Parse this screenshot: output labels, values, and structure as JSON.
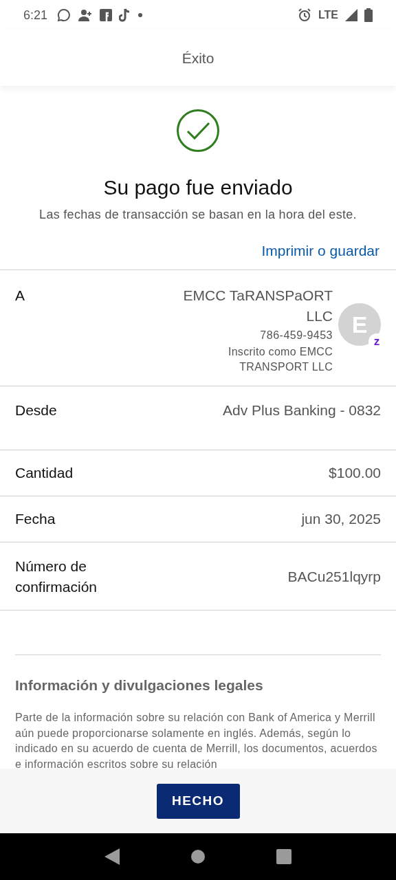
{
  "status_bar": {
    "time": "6:21",
    "network": "LTE"
  },
  "header": {
    "title": "Éxito"
  },
  "result": {
    "title": "Su pago fue enviado",
    "subtitle": "Las fechas de transacción se basan en la hora del este.",
    "print_link": "Imprimir o guardar"
  },
  "recipient": {
    "label": "A",
    "name": "EMCC TaRANSPaORT LLC",
    "phone": "786-459-9453",
    "enrolled_as": "Inscrito como EMCC TRANSPORT LLC",
    "avatar_letter": "E",
    "badge": "z"
  },
  "details": [
    {
      "label": "Desde",
      "value": "Adv Plus Banking - 0832"
    },
    {
      "label": "Cantidad",
      "value": "$100.00"
    },
    {
      "label": "Fecha",
      "value": "jun 30, 2025"
    },
    {
      "label": "Número de confirmación",
      "value": "BACu251lqyrp"
    }
  ],
  "legal": {
    "title": "Información y divulgaciones legales",
    "text": "Parte de la información sobre su relación con Bank of America y Merrill aún puede proporcionarse solamente en inglés. Además, según lo indicado en su acuerdo de cuenta de Merrill, los documentos, acuerdos e información escritos sobre su relación"
  },
  "footer": {
    "button": "HECHO"
  }
}
